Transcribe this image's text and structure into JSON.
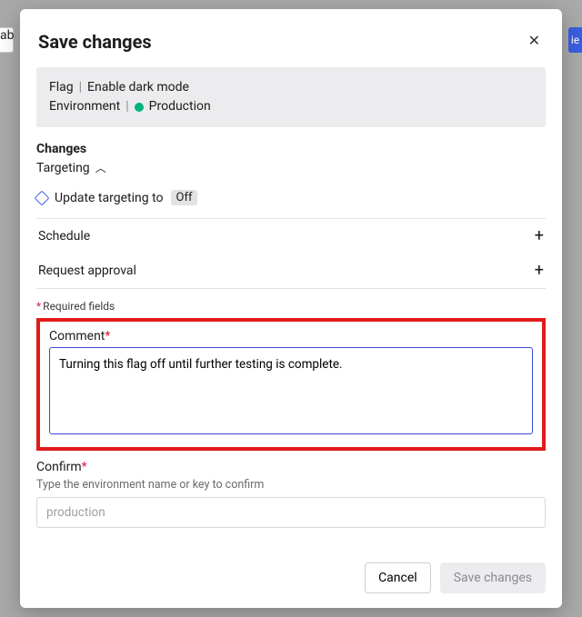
{
  "bg": {
    "left_tab": "ab",
    "right_tab": "ie"
  },
  "modal": {
    "title": "Save changes",
    "context": {
      "flag_label": "Flag",
      "flag_value": "Enable dark mode",
      "env_label": "Environment",
      "env_value": "Production"
    },
    "changes": {
      "heading": "Changes",
      "group": "Targeting",
      "update_prefix": "Update targeting to",
      "update_value": "Off"
    },
    "accordion": {
      "schedule": "Schedule",
      "approval": "Request approval"
    },
    "required_note": "Required fields",
    "comment": {
      "label": "Comment",
      "value": "Turning this flag off until further testing is complete."
    },
    "confirm": {
      "label": "Confirm",
      "hint": "Type the environment name or key to confirm",
      "placeholder": "production"
    },
    "buttons": {
      "cancel": "Cancel",
      "save": "Save changes"
    }
  }
}
